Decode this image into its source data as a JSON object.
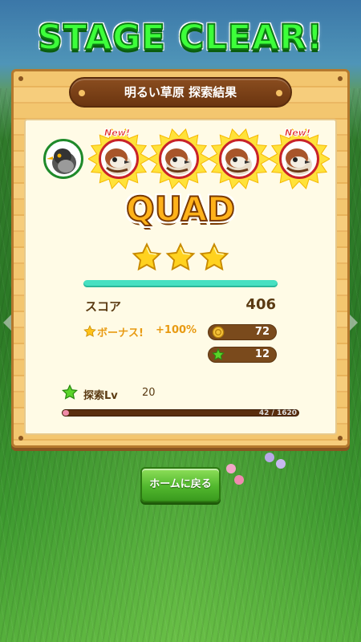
{
  "title": "STAGE CLEAR!",
  "panel_title": "明るい草原 探索結果",
  "birds": [
    {
      "name": "myna",
      "is_new": false
    },
    {
      "name": "sparrow",
      "is_new": true
    },
    {
      "name": "sparrow",
      "is_new": false
    },
    {
      "name": "sparrow",
      "is_new": false
    },
    {
      "name": "sparrow",
      "is_new": true
    }
  ],
  "new_label": "New!",
  "rank": "QUAD",
  "stars": 3,
  "score_label": "スコア",
  "score_value": "406",
  "bonus_label": "ボーナス!",
  "bonus_percent": "+100%",
  "rewards": {
    "coins": "72",
    "stars": "12"
  },
  "explore_level": {
    "label": "探索Lv",
    "value": "20",
    "progress_text": "42 / 1620",
    "progress_fraction": 0.026
  },
  "home_button": "ホームに戻る",
  "colors": {
    "title_green": "#3dff3a",
    "rank_orange": "#ffb21a",
    "progress_teal": "#46e0c1",
    "button_green": "#52b82e"
  },
  "icons": [
    "coin-icon",
    "green-star-icon",
    "gold-star-icon"
  ]
}
